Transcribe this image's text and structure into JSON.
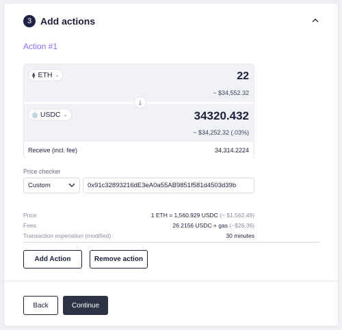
{
  "step": {
    "number": "3",
    "title": "Add actions"
  },
  "action": {
    "title": "Action #1"
  },
  "swap": {
    "from": {
      "token": "ETH",
      "amount": "22",
      "usd": "~ $34,552.32"
    },
    "to": {
      "token": "USDC",
      "amount": "34320.432",
      "usd": "~ $34,252.32 (.03%)"
    },
    "receive_label": "Receive (incl. fee)",
    "receive_value": "34,314.2224"
  },
  "price_checker": {
    "label": "Price checker",
    "selected": "Custom",
    "address": "0x91c32893216dE3eA0a55AB9851f581d4503d39b"
  },
  "info": {
    "price_label": "Price",
    "price_value": "1 ETH = 1,560.929 USDC",
    "price_usd": "(~ $1,562.49)",
    "fees_label": "Fees",
    "fees_value": "26.2156 USDC + gas",
    "fees_usd": "(~$26.36)",
    "expiration_label": "Transaction experiation (modified)",
    "expiration_value": "30 minutes"
  },
  "buttons": {
    "add_action": "Add Action",
    "remove_action": "Remove action",
    "back": "Back",
    "continue": "Continue"
  },
  "icons": {
    "collapse": "chevron-up-icon",
    "eth": "ethereum-icon",
    "usdc": "usdc-icon",
    "swap_arrow": "arrow-down-icon",
    "dropdown": "chevron-down-icon"
  },
  "colors": {
    "accent": "#8b6cf5",
    "primary_dark": "#2c3345",
    "step_badge": "#1f2147"
  }
}
